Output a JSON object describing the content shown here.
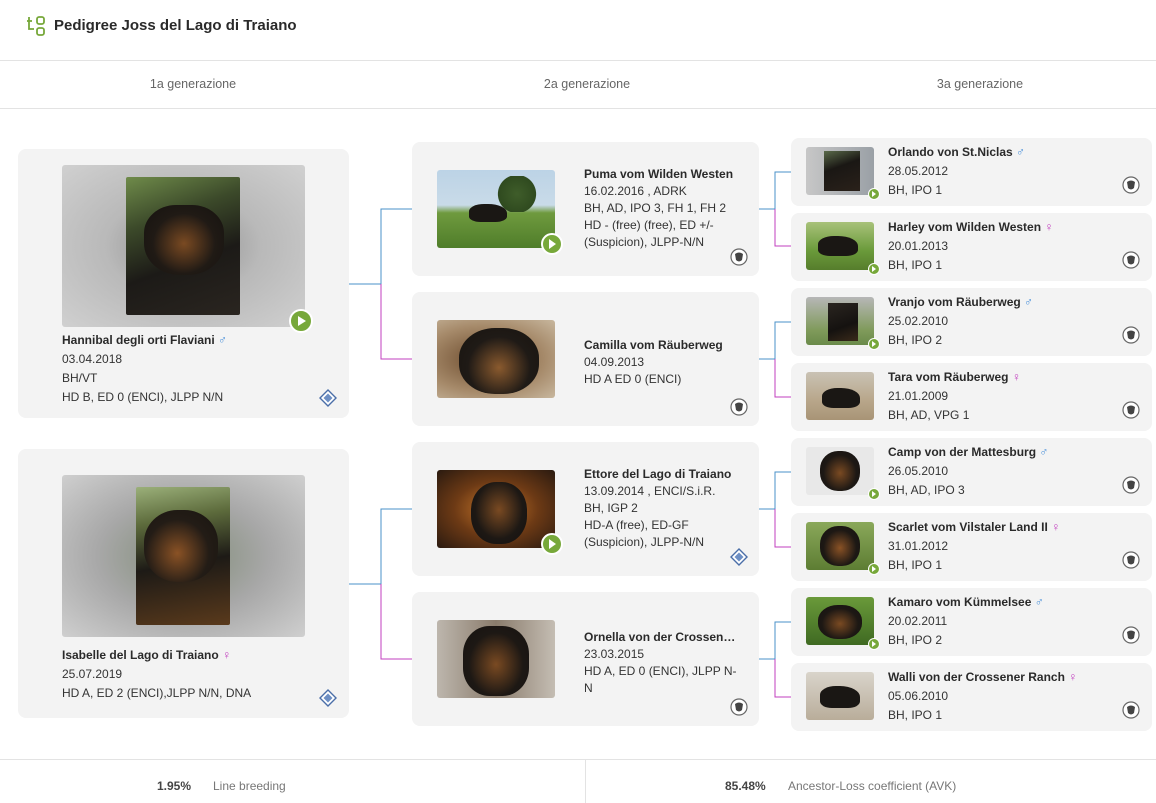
{
  "header": {
    "title": "Pedigree Joss del Lago di Traiano",
    "logo_icon": "pedigree-tree-icon"
  },
  "generations": [
    "1a generazione",
    "2a generazione",
    "3a generazione"
  ],
  "gen1": [
    {
      "name": "Hannibal degli orti Flaviani",
      "sex": "♂",
      "date": "03.04.2018",
      "title": "BH/VT",
      "health": "HD B, ED 0 (ENCI), JLPP N/N",
      "badge": "club-emblem-icon",
      "video": true
    },
    {
      "name": "Isabelle del Lago di Traiano",
      "sex": "♀",
      "date": "25.07.2019",
      "title": "",
      "health": "HD A, ED 2 (ENCI),JLPP N/N, DNA",
      "badge": "club-emblem-icon",
      "video": false
    }
  ],
  "gen2": [
    {
      "name": "Puma vom Wilden Westen",
      "line2": "16.02.2016 , ADRK",
      "line3": "BH, AD, IPO 3, FH 1, FH 2",
      "line4": "HD - (free) (free), ED +/- (Suspicion), JLPP-N/N (free), Scissor bite (A",
      "badge": "adrk-seal-icon",
      "video": true
    },
    {
      "name": "Camilla vom Räuberweg",
      "line2": "04.09.2013",
      "line3": "HD A ED 0 (ENCI)",
      "line4": "",
      "badge": "adrk-seal-icon",
      "video": false
    },
    {
      "name": "Ettore del Lago di Traiano",
      "line2": "13.09.2014 , ENCI/S.i.R.",
      "line3": "BH, IGP 2",
      "line4": "HD-A (free), ED-GF (Suspicion), JLPP-N/N (clear)",
      "badge": "club-emblem-icon",
      "video": true
    },
    {
      "name": "Ornella von der Crossener Ranch",
      "line2": "23.03.2015",
      "line3": "HD A, ED 0 (ENCI), JLPP N-N",
      "line4": "",
      "badge": "adrk-seal-icon",
      "video": false
    }
  ],
  "gen3": [
    {
      "name": "Orlando von St.Niclas",
      "sex": "♂",
      "date": "28.05.2012",
      "title": "BH, IPO 1",
      "video": true
    },
    {
      "name": "Harley vom Wilden Westen",
      "sex": "♀",
      "date": "20.01.2013",
      "title": "BH, IPO 1",
      "video": true
    },
    {
      "name": "Vranjo vom Räuberweg",
      "sex": "♂",
      "date": "25.02.2010",
      "title": "BH, IPO 2",
      "video": true
    },
    {
      "name": "Tara vom Räuberweg",
      "sex": "♀",
      "date": "21.01.2009",
      "title": "BH, AD, VPG 1",
      "video": false
    },
    {
      "name": "Camp von der Mattesburg",
      "sex": "♂",
      "date": "26.05.2010",
      "title": "BH, AD, IPO 3",
      "video": true
    },
    {
      "name": "Scarlet vom Vilstaler Land II",
      "sex": "♀",
      "date": "31.01.2012",
      "title": "BH, IPO 1",
      "video": true
    },
    {
      "name": "Kamaro vom Kümmelsee",
      "sex": "♂",
      "date": "20.02.2011",
      "title": "BH, IPO 2",
      "video": true
    },
    {
      "name": "Walli von der Crossener Ranch",
      "sex": "♀",
      "date": "05.06.2010",
      "title": "BH, IPO 1",
      "video": false
    }
  ],
  "footer": {
    "line_breeding_value": "1.95%",
    "line_breeding_label": "Line breeding",
    "avk_value": "85.48%",
    "avk_label": "Ancestor-Loss coefficient (AVK)"
  },
  "colors": {
    "accent_green": "#77a83a",
    "male": "#4a90d9",
    "female": "#c23fbf",
    "line_male": "#4a90c8",
    "line_female": "#c23fbf"
  }
}
